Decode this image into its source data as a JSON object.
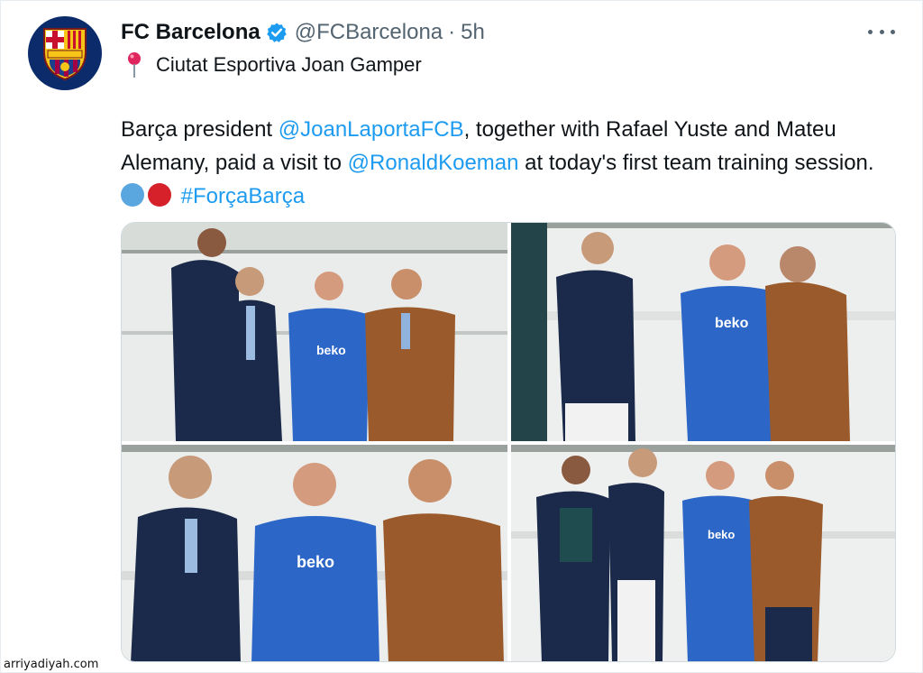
{
  "account": {
    "name": "FC Barcelona",
    "handle": "@FCBarcelona",
    "separator": "·",
    "time": "5h",
    "verified": true,
    "avatar_icon": "fc-barcelona-crest-icon"
  },
  "location": {
    "icon": "map-pin-icon",
    "label": "Ciutat Esportiva Joan Gamper"
  },
  "tweet": {
    "t1": "Barça president ",
    "mention1": "@JoanLaportaFCB",
    "t2": ", together with Rafael Yuste and Mateu Alemany, paid a visit to ",
    "mention2": "@RonaldKoeman",
    "t3": " at today's first team training session. ",
    "emoji": [
      "blue-circle",
      "red-circle"
    ],
    "hashtag": "#ForçaBarça"
  },
  "media": {
    "count": 4,
    "photos": [
      "photo-1",
      "photo-2",
      "photo-3",
      "photo-4"
    ],
    "shirt_text": "beko"
  },
  "watermark": "arriyadiyah.com",
  "colors": {
    "accent": "#1d9bf0",
    "text": "#0f1419",
    "muted": "#536471",
    "shirt_blue": "#2c67c8",
    "jacket_brown": "#9a5a2c",
    "navy": "#1b2a4a"
  }
}
